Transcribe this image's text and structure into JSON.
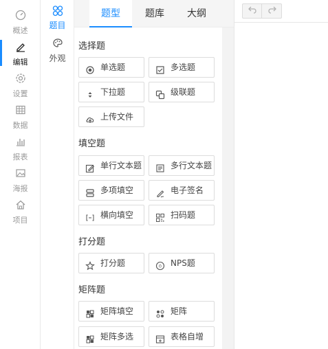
{
  "left_nav": {
    "items": [
      {
        "label": "概述",
        "icon": "gauge-icon"
      },
      {
        "label": "编辑",
        "icon": "pencil-icon",
        "active": true
      },
      {
        "label": "设置",
        "icon": "gear-icon"
      },
      {
        "label": "数据",
        "icon": "grid-icon"
      },
      {
        "label": "报表",
        "icon": "bar-chart-icon"
      },
      {
        "label": "海报",
        "icon": "image-icon"
      },
      {
        "label": "项目",
        "icon": "home-icon"
      }
    ]
  },
  "sub_nav": {
    "items": [
      {
        "label": "题目",
        "icon": "question-nodes-icon",
        "active": true
      },
      {
        "label": "外观",
        "icon": "palette-icon"
      }
    ]
  },
  "tabs": [
    {
      "label": "题型",
      "active": true
    },
    {
      "label": "题库"
    },
    {
      "label": "大纲"
    }
  ],
  "sections": {
    "choice": {
      "title": "选择题",
      "items": [
        "单选题",
        "多选题",
        "下拉题",
        "级联题",
        "上传文件"
      ]
    },
    "fill": {
      "title": "填空题",
      "items": [
        "单行文本题",
        "多行文本题",
        "多项填空",
        "电子签名",
        "横向填空",
        "扫码题"
      ]
    },
    "score": {
      "title": "打分题",
      "items": [
        "打分题",
        "NPS题"
      ]
    },
    "matrix": {
      "title": "矩阵题",
      "items": [
        "矩阵填空",
        "矩阵",
        "矩阵多选",
        "表格自增"
      ]
    }
  },
  "colors": {
    "accent": "#1a8cff",
    "border": "#dcdcdc",
    "muted_text": "#9a9a9a"
  }
}
